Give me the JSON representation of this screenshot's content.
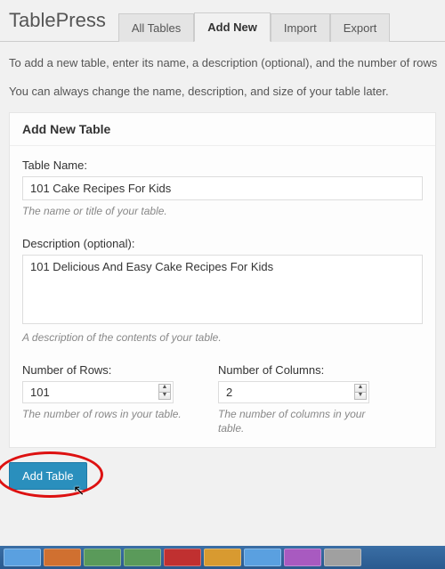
{
  "header": {
    "logo": "TablePress",
    "tabs": [
      {
        "label": "All Tables",
        "active": false
      },
      {
        "label": "Add New",
        "active": true
      },
      {
        "label": "Import",
        "active": false
      },
      {
        "label": "Export",
        "active": false
      }
    ]
  },
  "intro_line1": "To add a new table, enter its name, a description (optional), and the number of rows",
  "intro_line2": "You can always change the name, description, and size of your table later.",
  "panel": {
    "title": "Add New Table",
    "name_label": "Table Name:",
    "name_value": "101 Cake Recipes For Kids",
    "name_hint": "The name or title of your table.",
    "desc_label": "Description (optional):",
    "desc_value": "101 Delicious And Easy Cake Recipes For Kids",
    "desc_hint": "A description of the contents of your table.",
    "rows_label": "Number of Rows:",
    "rows_value": "101",
    "rows_hint": "The number of rows in your table.",
    "cols_label": "Number of Columns:",
    "cols_value": "2",
    "cols_hint": "The number of columns in your table."
  },
  "submit_label": "Add Table",
  "taskbar_colors": [
    "#5aa0e0",
    "#d07030",
    "#5a9a5a",
    "#5a9a5a",
    "#c03030",
    "#d89a30",
    "#5aa0e0",
    "#a85ac0",
    "#a0a0a0"
  ]
}
